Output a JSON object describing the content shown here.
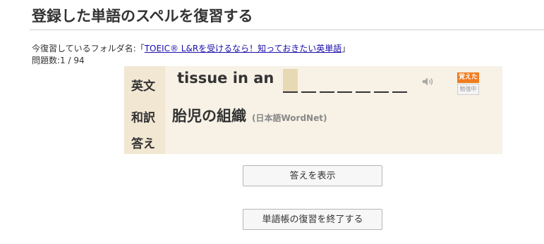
{
  "page": {
    "title": "登録した単語のスペルを復習する"
  },
  "folder": {
    "prefix": "今復習しているフォルダ名:「",
    "name": "TOEIC® L&Rを受けるなら！知っておきたい英単語",
    "suffix": "」"
  },
  "count": {
    "text": "問題数:1 / 94"
  },
  "card": {
    "labels": {
      "english": "英文",
      "japanese": "和訳",
      "answer": "答え"
    },
    "question_text": "tissue in an",
    "blank_count": 7,
    "active_blank_index": 0,
    "translation": "胎児の組織",
    "source": "(日本語WordNet)",
    "answer_text": "",
    "badges": {
      "learned": "覚えた",
      "studying": "勉強中"
    },
    "icons": {
      "speaker": "speaker-icon"
    }
  },
  "buttons": {
    "show_answer": "答えを表示",
    "end_review": "単語帳の復習を終了する"
  },
  "colors": {
    "card_bg": "#f7f1e6",
    "label_bg": "#f1e7d2",
    "active_blank": "#e8d9b5",
    "learned_badge": "#f07c20",
    "link": "#1a0dab"
  }
}
